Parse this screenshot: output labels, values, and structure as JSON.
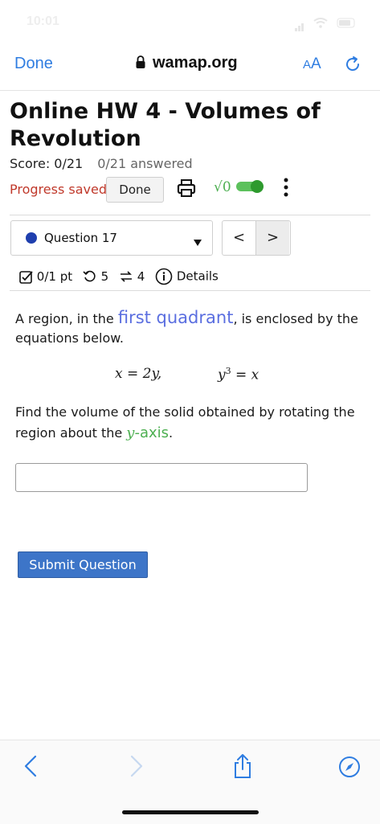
{
  "status_bar": {
    "time": "10:01"
  },
  "browser": {
    "done_label": "Done",
    "url": "wamap.org",
    "aa_small": "A",
    "aa_large": "A"
  },
  "header": {
    "title": "Online HW 4 - Volumes of Revolution",
    "score": "Score: 0/21",
    "answered": "0/21 answered",
    "progress_saved": "Progress saved",
    "done_button": "Done",
    "sqrt_label": "√0"
  },
  "question_nav": {
    "question_label": "Question 17",
    "prev": "<",
    "next": ">"
  },
  "meta": {
    "points": "0/1 pt",
    "attempts": "5",
    "regens": "4",
    "details": "Details"
  },
  "question": {
    "text_before": "A region, in the ",
    "highlight_1": "first quadrant",
    "text_after": ", is enclosed by the equations below.",
    "eq1": "x = 2y,",
    "eq2_base": "y",
    "eq2_exp": "3",
    "eq2_rest": " = x",
    "find_before": "Find the volume of the solid obtained by rotating the region about the ",
    "axis_var": "y",
    "axis_suffix": "-axis",
    "find_after": ".",
    "answer_value": "",
    "submit_label": "Submit Question"
  },
  "colors": {
    "accent": "#2f7de1",
    "submit": "#3d75c8",
    "progress_saved": "#c0392b",
    "highlight_blue": "#5a6ee0",
    "highlight_green": "#4caf50"
  },
  "icons": [
    "lock-icon",
    "reload-icon",
    "printer-icon",
    "toggle-icon",
    "more-icon",
    "caret-down-icon",
    "checkbox-icon",
    "retry-icon",
    "regen-icon",
    "info-icon",
    "back-icon",
    "forward-icon",
    "share-icon",
    "compass-icon"
  ]
}
